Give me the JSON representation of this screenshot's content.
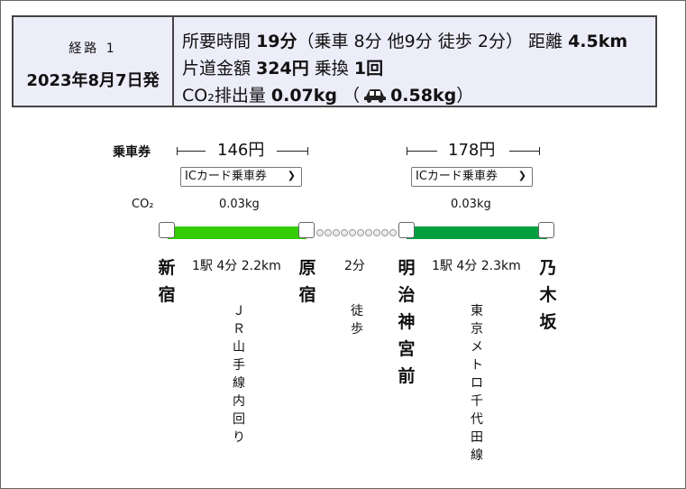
{
  "summary": {
    "route_label": "経路 1",
    "date": "2023年8月7日発",
    "time_label": "所要時間",
    "total_time": "19分",
    "time_detail": "（乗車 8分  他9分  徒歩 2分）",
    "distance_label": "距離",
    "distance": "4.5km",
    "fare_label": "片道金額",
    "fare": "324円",
    "transfer_label": "乗換",
    "transfers": "1回",
    "co2_label": "CO₂排出量",
    "co2": "0.07kg",
    "car_co2_open": "（",
    "car_co2": "0.58kg",
    "car_co2_close": "）",
    "car_icon": "car-icon"
  },
  "diagram": {
    "ticket_title": "乗車券",
    "co2_label": "CO₂",
    "segments": [
      {
        "fare": "146円",
        "ticket_type": "ICカード乗車券",
        "co2": "0.03kg",
        "info": "1駅 4分 2.2km",
        "line_name": "ＪＲ山手線内回り",
        "color": "#33cc00"
      },
      {
        "info": "2分",
        "line_name": "徒歩"
      },
      {
        "fare": "178円",
        "ticket_type": "ICカード乗車券",
        "co2": "0.03kg",
        "info": "1駅 4分 2.3km",
        "line_name": "東京メトロ千代田線",
        "color": "#00a040"
      }
    ],
    "stations": [
      "新宿",
      "原宿",
      "明治神宮前",
      "乃木坂"
    ]
  }
}
